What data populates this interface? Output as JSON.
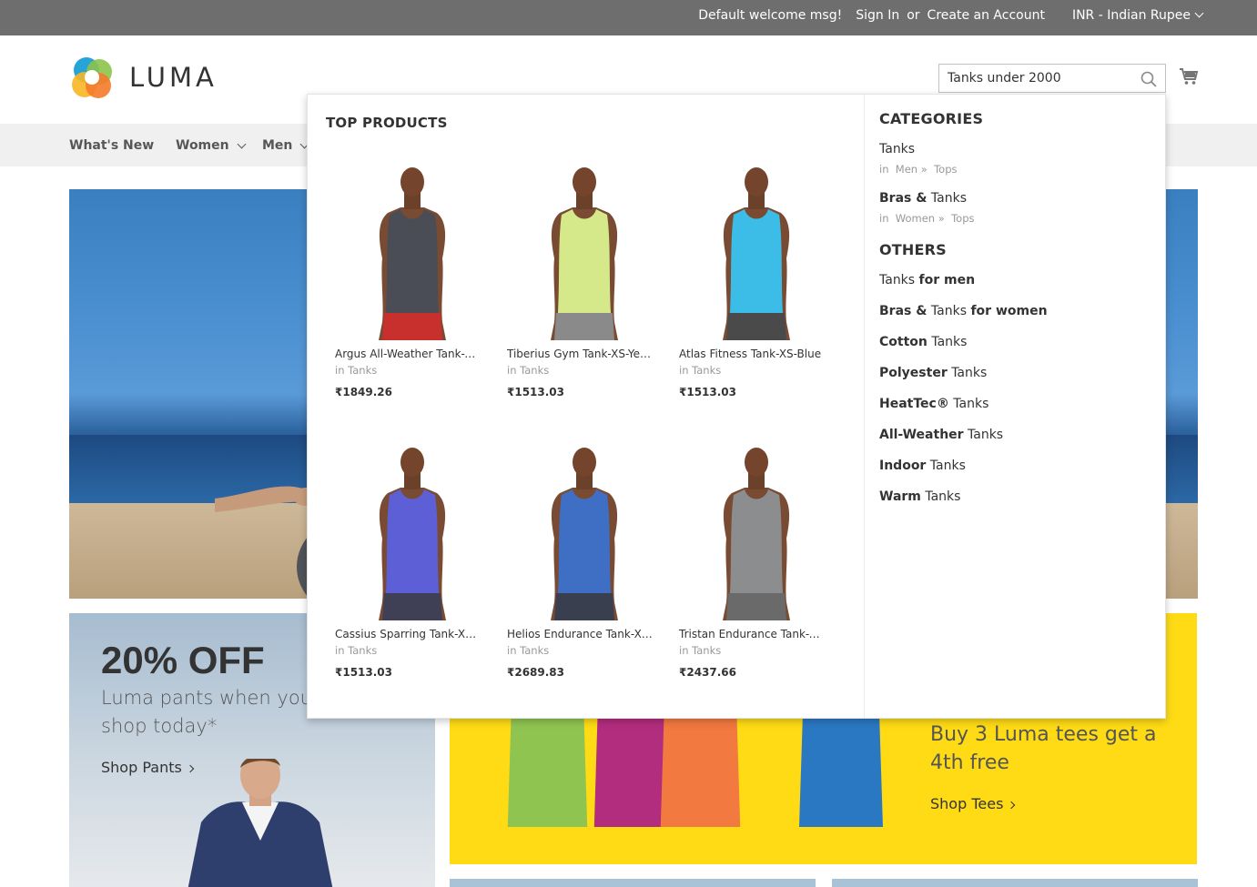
{
  "topbar": {
    "welcome": "Default welcome msg!",
    "sign_in": "Sign In",
    "or": "or",
    "create_account": "Create an Account",
    "currency": "INR - Indian Rupee"
  },
  "logo": {
    "text": "LUMA"
  },
  "search": {
    "value": "Tanks under 2000"
  },
  "nav": {
    "items": [
      "What's New",
      "Women",
      "Men"
    ]
  },
  "dropdown": {
    "top_products_title": "TOP PRODUCTS",
    "products": [
      {
        "name": "Argus All-Weather Tank-X...",
        "category": "in Tanks",
        "price": "₹1849.26",
        "shirt_color": "#4a4d55",
        "shorts_color": "#c8302e"
      },
      {
        "name": "Tiberius Gym Tank-XS-Yell...",
        "category": "in Tanks",
        "price": "₹1513.03",
        "shirt_color": "#d6e98a",
        "shorts_color": "#8a8a8a"
      },
      {
        "name": "Atlas Fitness Tank-XS-Blue",
        "category": "in Tanks",
        "price": "₹1513.03",
        "shirt_color": "#3bbde8",
        "shorts_color": "#4a4a4a"
      },
      {
        "name": "Cassius Sparring Tank-XS-...",
        "category": "in Tanks",
        "price": "₹1513.03",
        "shirt_color": "#5c5fd6",
        "shorts_color": "#3f3f55"
      },
      {
        "name": "Helios Endurance Tank-XS...",
        "category": "in Tanks",
        "price": "₹2689.83",
        "shirt_color": "#3f6fc4",
        "shorts_color": "#3a3f50"
      },
      {
        "name": "Tristan Endurance Tank-X...",
        "category": "in Tanks",
        "price": "₹2437.66",
        "shirt_color": "#8c8d8f",
        "shorts_color": "#6a6a6a"
      }
    ],
    "categories_title": "CATEGORIES",
    "categories": [
      {
        "prefix": "",
        "name": "Tanks",
        "path_in": "in",
        "path_a": "Men »",
        "path_b": "Tops"
      },
      {
        "prefix": "Bras &",
        "name": "Tanks",
        "path_in": "in",
        "path_a": "Women »",
        "path_b": "Tops"
      }
    ],
    "others_title": "OTHERS",
    "others": [
      {
        "pre": "",
        "mid": "Tanks",
        "post": "for men"
      },
      {
        "pre": "Bras &",
        "mid": "Tanks",
        "post": "for women"
      },
      {
        "pre": "Cotton",
        "mid": "Tanks",
        "post": ""
      },
      {
        "pre": "Polyester",
        "mid": "Tanks",
        "post": ""
      },
      {
        "pre": "HeatTec®",
        "mid": "Tanks",
        "post": ""
      },
      {
        "pre": "All-Weather",
        "mid": "Tanks",
        "post": ""
      },
      {
        "pre": "Indoor",
        "mid": "Tanks",
        "post": ""
      },
      {
        "pre": "Warm",
        "mid": "Tanks",
        "post": ""
      }
    ]
  },
  "promo_left": {
    "headline": "20% OFF",
    "subtext": "Luma pants when you shop today*",
    "link": "Shop Pants"
  },
  "promo_right": {
    "text": "Buy 3 Luma tees get a 4th free",
    "link": "Shop Tees",
    "tee_colors": [
      "#8fc451",
      "#b22d7e",
      "#f27940",
      "#2a78c2"
    ]
  }
}
